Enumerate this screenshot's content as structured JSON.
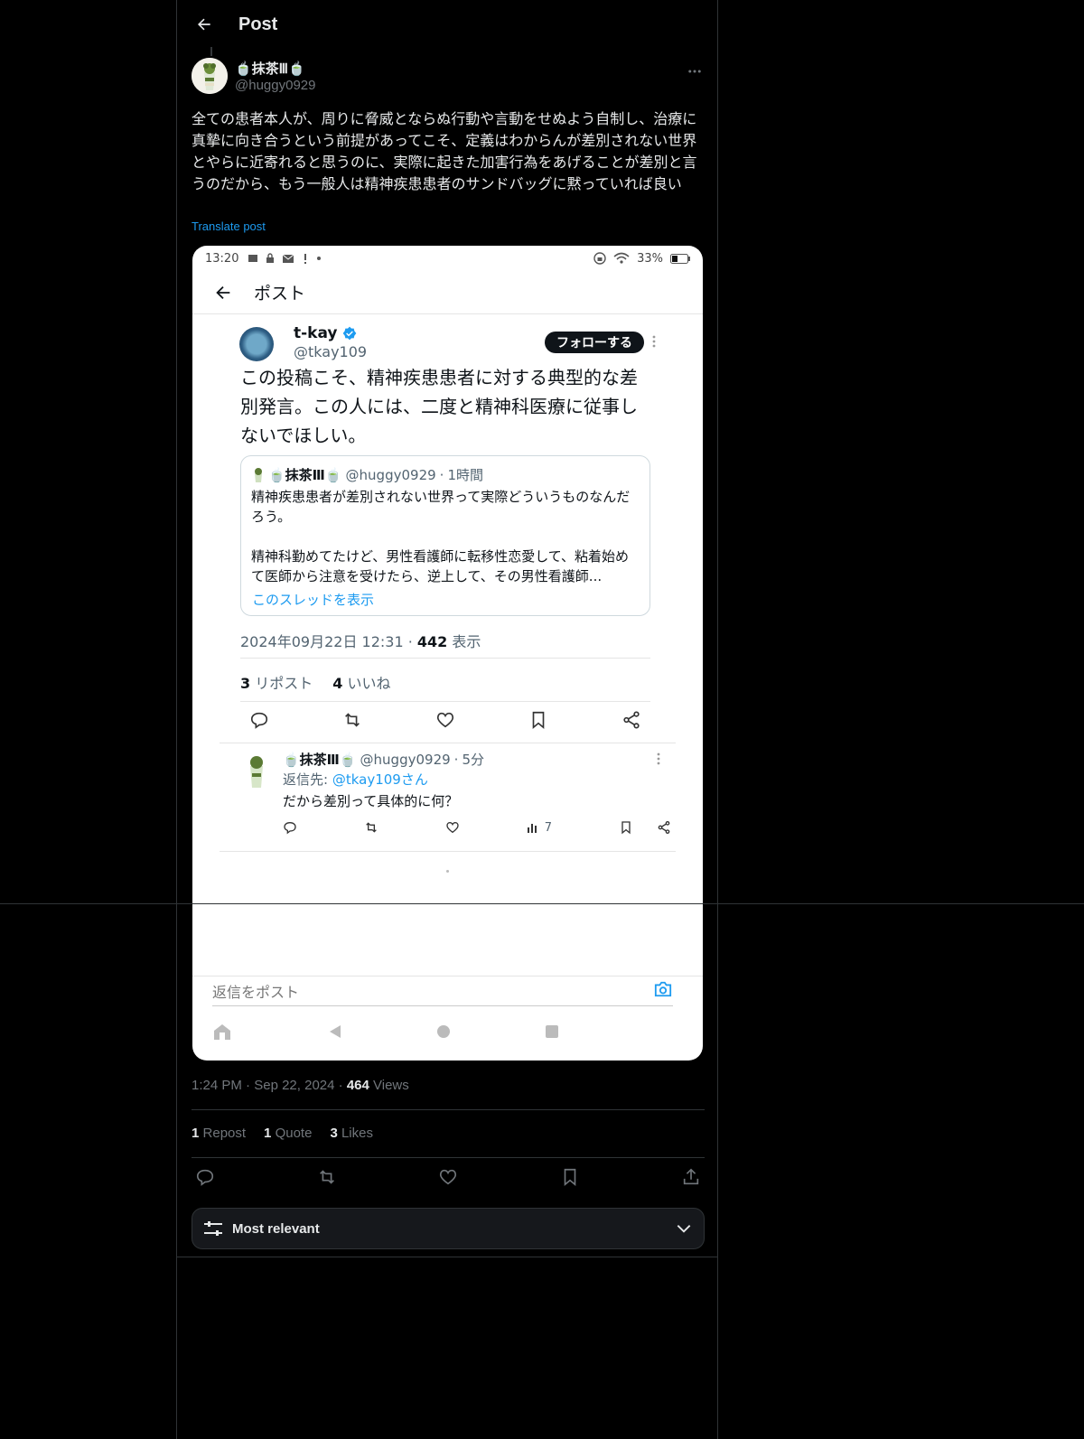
{
  "header": {
    "title": "Post"
  },
  "author": {
    "name": "🍵抹茶Ⅲ🍵",
    "handle": "@huggy0929"
  },
  "post": {
    "text": "全ての患者本人が、周りに脅威とならぬ行動や言動をせぬよう自制し、治療に真摯に向き合うという前提があってこそ、定義はわからんが差別されない世界とやらに近寄れると思うのに、実際に起きた加害行為をあげることが差別と言うのだから、もう一般人は精神疾患患者のサンドバッグに黙っていれば良い",
    "translate_label": "Translate post",
    "time": "1:24 PM",
    "date": "Sep 22, 2024",
    "views_count": "464",
    "views_label": "Views",
    "reposts_count": "1",
    "reposts_label": "Repost",
    "quotes_count": "1",
    "quotes_label": "Quote",
    "likes_count": "3",
    "likes_label": "Likes"
  },
  "sort": {
    "label": "Most relevant"
  },
  "screenshot": {
    "status_time": "13:20",
    "battery": "33%",
    "header_title": "ポスト",
    "poster_name": "t-kay",
    "poster_handle": "@tkay109",
    "follow_label": "フォローする",
    "text": "この投稿こそ、精神疾患患者に対する典型的な差別発言。この人には、二度と精神科医療に従事しないでほしい。",
    "quote": {
      "name": "🍵抹茶Ⅲ🍵",
      "handle": "@huggy0929",
      "age": "1時間",
      "line1": "精神疾患患者が差別されない世界って実際どういうものなんだろう。",
      "line2": "精神科勤めてたけど、男性看護師に転移性恋愛して、粘着始めて医師から注意を受けたら、逆上して、その男性看護師...",
      "thread_link": "このスレッドを表示"
    },
    "meta_date": "2024年09月22日 12:31",
    "meta_views_count": "442",
    "meta_views_label": "表示",
    "reposts_count": "3",
    "reposts_label": "リポスト",
    "likes_count": "4",
    "likes_label": "いいね",
    "reply": {
      "name": "🍵抹茶Ⅲ🍵",
      "handle": "@huggy0929",
      "age": "5分",
      "reply_to_label": "返信先:",
      "reply_to_handle": "@tkay109さん",
      "text": "だから差別って具体的に何？",
      "views": "7"
    },
    "reply_placeholder": "返信をポスト"
  },
  "colors": {
    "accent": "#1d9bf0",
    "background": "#000000",
    "border": "#2f3336"
  }
}
